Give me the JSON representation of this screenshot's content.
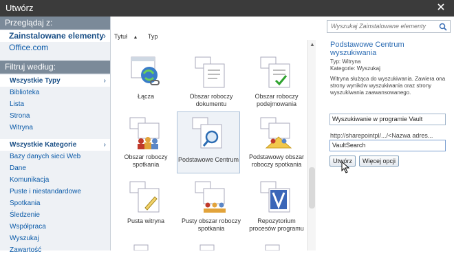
{
  "window": {
    "title": "Utwórz"
  },
  "sidebar": {
    "browse_heading": "Przeglądaj z:",
    "sources": [
      {
        "label": "Zainstalowane elementy"
      },
      {
        "label": "Office.com"
      }
    ],
    "filter_heading": "Filtruj według:",
    "types": [
      "Wszystkie Typy",
      "Biblioteka",
      "Lista",
      "Strona",
      "Witryna"
    ],
    "categories": [
      "Wszystkie Kategorie",
      "Bazy danych sieci Web",
      "Dane",
      "Komunikacja",
      "Puste i niestandardowe",
      "Spotkania",
      "Śledzenie",
      "Współpraca",
      "Wyszukaj",
      "Zawartość"
    ]
  },
  "sort": {
    "title": "Tytuł",
    "type": "Typ"
  },
  "tiles": [
    {
      "label": "Łącza"
    },
    {
      "label": "Obszar roboczy dokumentu"
    },
    {
      "label": "Obszar roboczy podejmowania"
    },
    {
      "label": "Obszar roboczy spotkania"
    },
    {
      "label": "Podstawowe Centrum"
    },
    {
      "label": "Podstawowy obszar roboczy spotkania"
    },
    {
      "label": "Pusta witryna"
    },
    {
      "label": "Pusty obszar roboczy spotkania"
    },
    {
      "label": "Repozytorium procesów programu"
    }
  ],
  "details": {
    "search_placeholder": "Wyszukaj Zainstalowane elementy",
    "title": "Podstawowe Centrum wyszukiwania",
    "type_line": "Typ: Witryna",
    "category_line": "Kategorie: Wyszukaj",
    "description": "Witryna służąca do wyszukiwania. Zawiera ona strony wyników wyszukiwania oraz strony wyszukiwania zaawansowanego.",
    "name_value": "Wyszukiwanie w programie Vault",
    "url_prefix": "http://sharepointpl/.../<Nazwa adres...",
    "url_value": "VaultSearch",
    "create_button": "Utwórz",
    "more_button": "Więcej opcji"
  },
  "colors": {
    "accent": "#2c6cb3",
    "sidebar_bg": "#eef1f5",
    "heading_bg": "#7b8a99",
    "titlebar": "#3b3b3b"
  }
}
